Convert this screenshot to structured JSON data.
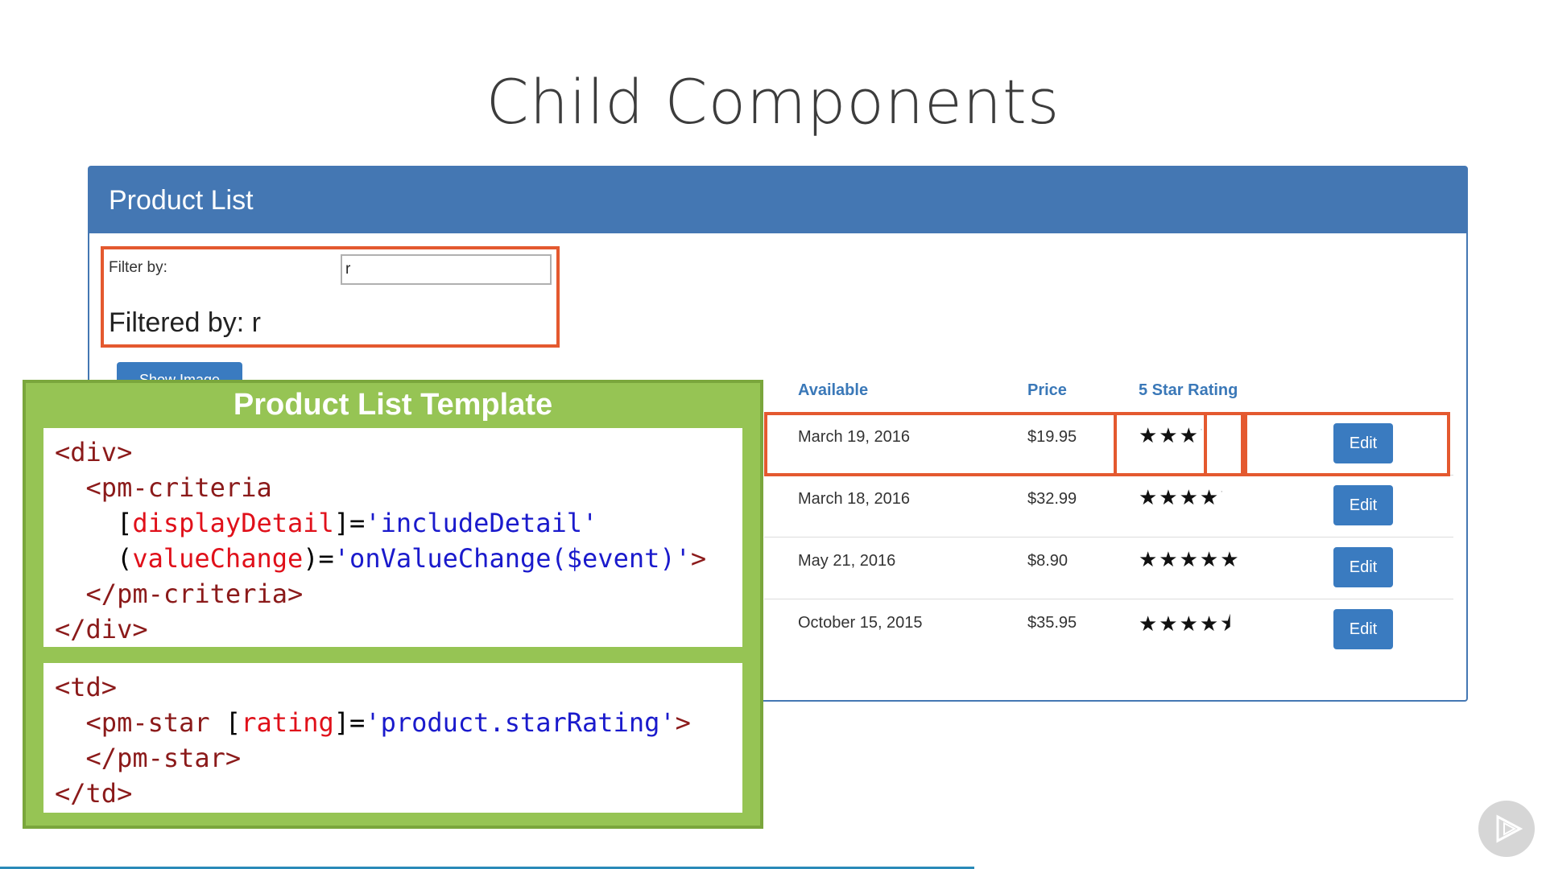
{
  "slide": {
    "title": "Child Components"
  },
  "panel": {
    "title": "Product List",
    "filter_label": "Filter by:",
    "filter_value": "r",
    "filtered_by": "Filtered by: r",
    "show_image_label": "Show Image"
  },
  "table": {
    "headers": [
      "Available",
      "Price",
      "5 Star Rating"
    ],
    "rows": [
      {
        "available": "March 19, 2016",
        "price": "$19.95",
        "rating": 3.2,
        "stars": "★★★",
        "edit": "Edit"
      },
      {
        "available": "March 18, 2016",
        "price": "$32.99",
        "rating": 4.2,
        "stars": "★★★★",
        "edit": "Edit"
      },
      {
        "available": "May 21, 2016",
        "price": "$8.90",
        "rating": 4.8,
        "stars": "★★★★★",
        "edit": "Edit"
      },
      {
        "available": "October 15, 2015",
        "price": "$35.95",
        "rating": 4.6,
        "stars": "★★★★⯨",
        "edit": "Edit"
      }
    ]
  },
  "template": {
    "title": "Product List Template",
    "code1": {
      "l1": "<div>",
      "l2": "  <pm-criteria",
      "l3_indent": "    [",
      "l3_attr": "displayDetail",
      "l3_mid": "]=",
      "l3_val": "'includeDetail'",
      "l4_indent": "    (",
      "l4_attr": "valueChange",
      "l4_mid": ")=",
      "l4_val": "'onValueChange($event)'",
      "l4_end": ">",
      "l5": "  </pm-criteria>",
      "l6": "</div>"
    },
    "code2": {
      "l1": "<td>",
      "l2_tag": "  <pm-star ",
      "l2_open": "[",
      "l2_attr": "rating",
      "l2_mid": "]=",
      "l2_val": "'product.starRating'",
      "l2_end": ">",
      "l3": "  </pm-star>",
      "l4": "</td>"
    }
  },
  "colors": {
    "header_blue": "#4477b3",
    "highlight_orange": "#e4592f",
    "template_green": "#96c454"
  },
  "icons": [
    "play-icon"
  ]
}
